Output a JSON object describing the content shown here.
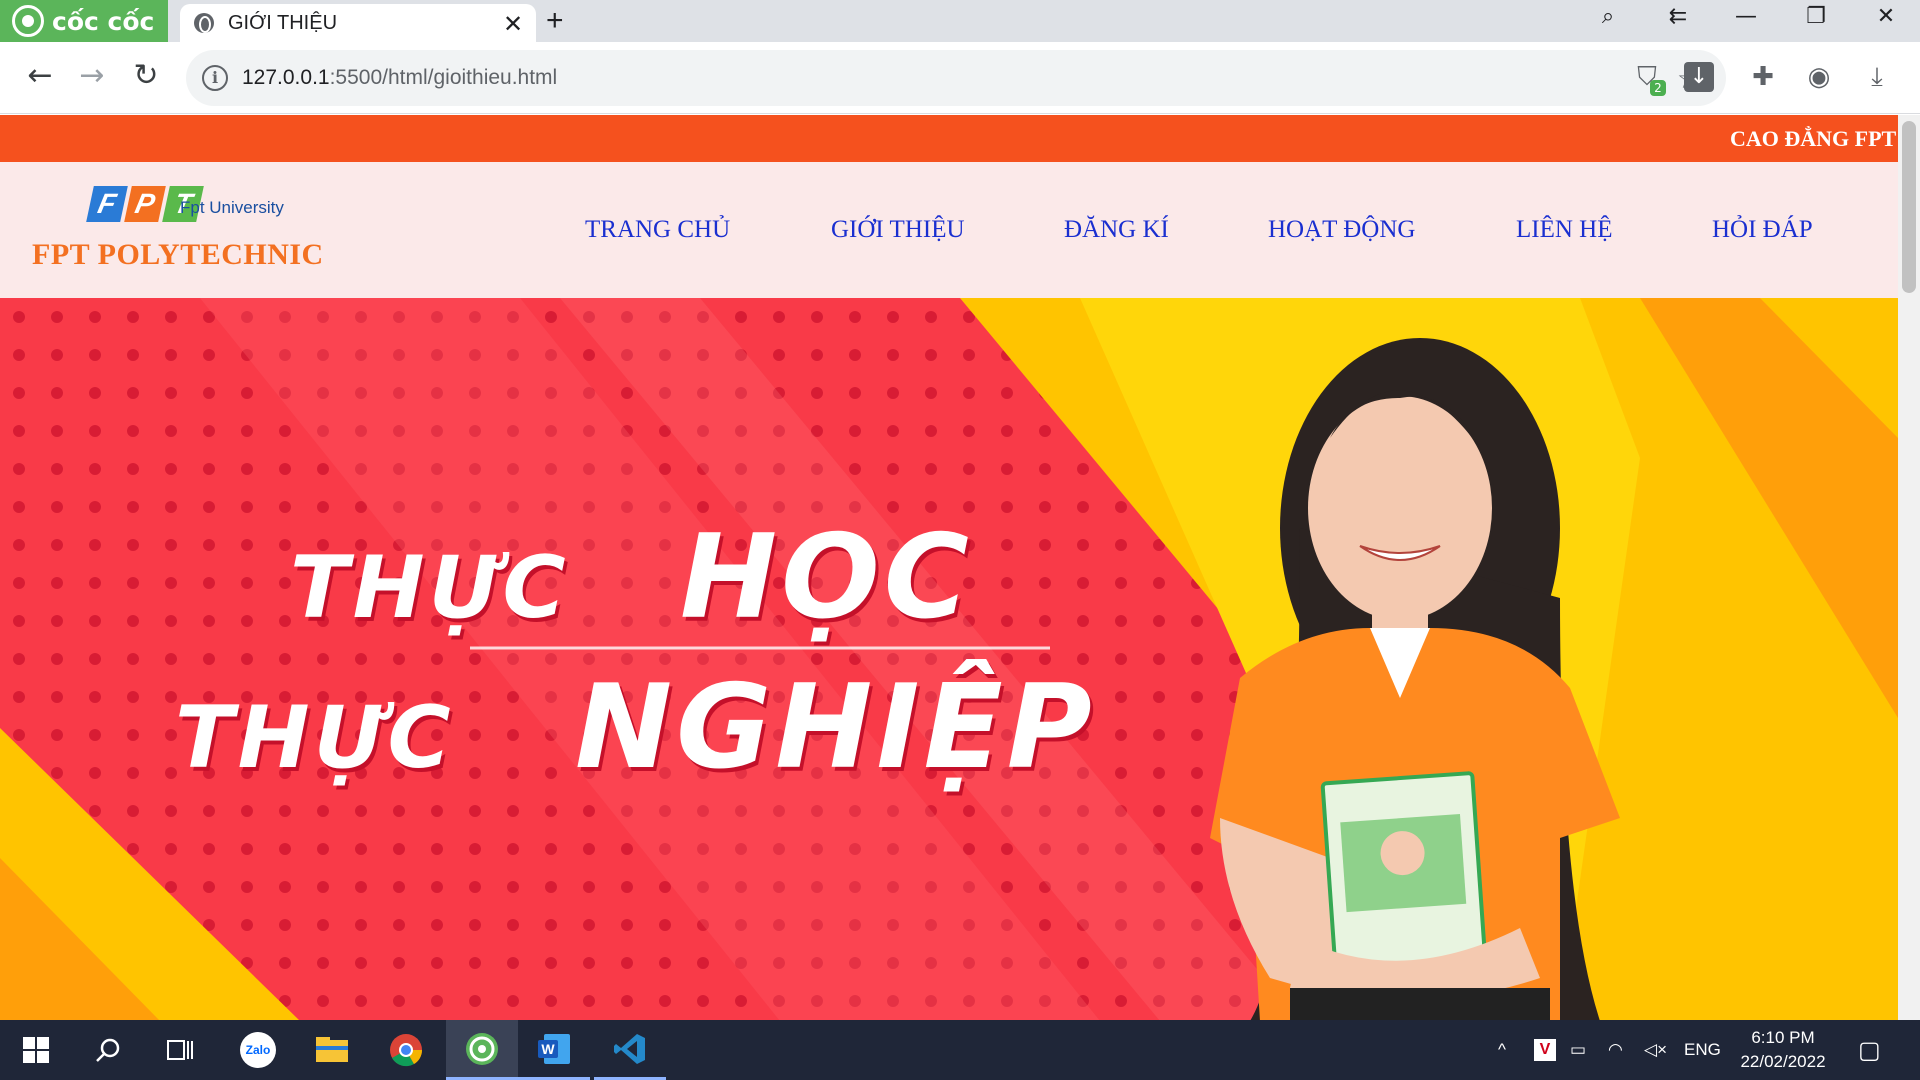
{
  "browser": {
    "brand": "cốc cốc",
    "tab_title": "GIỚI THIỆU",
    "url_host": "127.0.0.1",
    "url_path": ":5500/html/gioithieu.html",
    "extension_badge": "2"
  },
  "site": {
    "marquee_text": "CAO ĐẲNG FPT",
    "logo_letters": [
      "F",
      "P",
      "T"
    ],
    "logo_letter_colors": [
      "#2a7bd6",
      "#f37021",
      "#5ab94b"
    ],
    "logo_university": "Fpt University",
    "logo_name": "FPT POLYTECHNIC",
    "nav": [
      "TRANG CHỦ",
      "GIỚI THIỆU",
      "ĐĂNG KÍ",
      "HOẠT ĐỘNG",
      "LIÊN HỆ",
      "HỎI ĐÁP"
    ],
    "hero": {
      "line1_small": "THỰC",
      "line1_big": "HỌC",
      "line2_small": "THỰC",
      "line2_big": "NGHIỆP"
    }
  },
  "colors": {
    "marquee_bg": "#f5511e",
    "header_bg": "#fbe9e9",
    "nav_text": "#1a2fd0",
    "hero_red": "#f93a48",
    "hero_yellow": "#ffc400"
  },
  "taskbar": {
    "apps": [
      "start-icon",
      "search-icon",
      "task-view-icon",
      "zalo-icon",
      "file-explorer-icon",
      "chrome-icon",
      "coccoc-icon",
      "word-icon",
      "vscode-icon"
    ],
    "zalo_label": "Zalo",
    "language": "ENG",
    "time": "6:10 PM",
    "date": "22/02/2022"
  }
}
